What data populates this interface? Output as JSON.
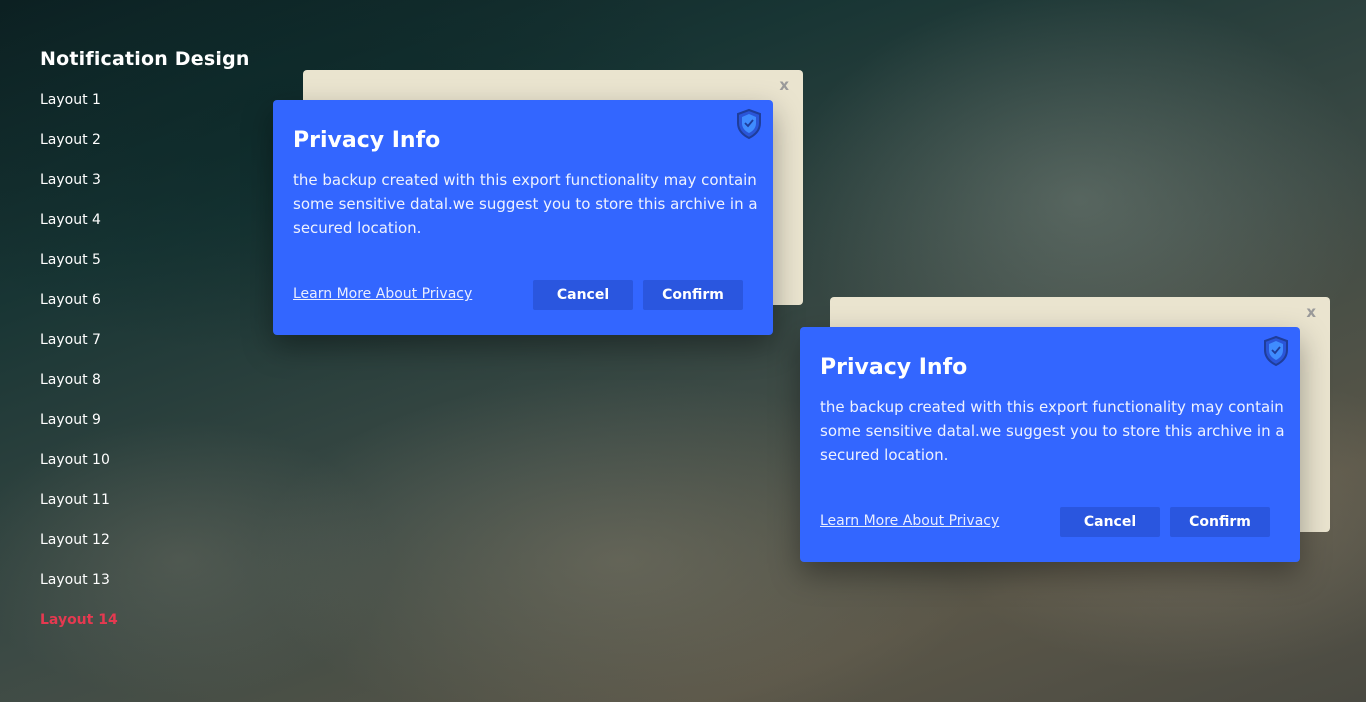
{
  "sidebar": {
    "title": "Notification Design",
    "items": [
      {
        "label": "Layout 1"
      },
      {
        "label": "Layout 2"
      },
      {
        "label": "Layout 3"
      },
      {
        "label": "Layout 4"
      },
      {
        "label": "Layout 5"
      },
      {
        "label": "Layout 6"
      },
      {
        "label": "Layout 7"
      },
      {
        "label": "Layout 8"
      },
      {
        "label": "Layout 9"
      },
      {
        "label": "Layout 10"
      },
      {
        "label": "Layout 11"
      },
      {
        "label": "Layout 12"
      },
      {
        "label": "Layout 13"
      },
      {
        "label": "Layout 14"
      }
    ],
    "active_label": "Layout 14",
    "active_color": "#e53950"
  },
  "dialogs": [
    {
      "close_label": "x",
      "title": "Privacy Info",
      "body": "the backup created with this export functionality may contain some sensitive datal.we suggest you to store this archive in a secured location.",
      "link": "Learn More About Privacy",
      "cancel": "Cancel",
      "confirm": "Confirm",
      "icon": "shield-check-icon"
    },
    {
      "close_label": "x",
      "title": "Privacy Info",
      "body": "the backup created with this export functionality may contain some sensitive datal.we suggest you to store this archive in a secured location.",
      "link": "Learn More About Privacy",
      "cancel": "Cancel",
      "confirm": "Confirm",
      "icon": "shield-check-icon"
    }
  ],
  "colors": {
    "dialog_bg": "#3366ff",
    "button_bg": "#2a56df",
    "card_bg": "#eae4cf"
  }
}
